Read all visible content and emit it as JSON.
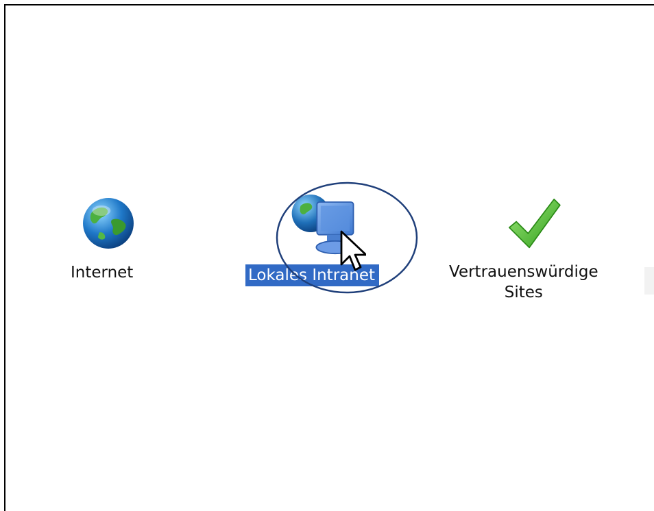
{
  "zones": {
    "internet": {
      "label": "Internet",
      "icon": "globe-icon"
    },
    "intranet": {
      "label": "Lokales Intranet",
      "icon": "local-intranet-icon",
      "selected": true
    },
    "trusted": {
      "label_line1": "Vertrauenswürdige",
      "label_line2": "Sites",
      "icon": "checkmark-icon"
    }
  },
  "colors": {
    "selection_highlight": "#316ac5",
    "annotation_ellipse": "#1f3f7a",
    "checkmark_green": "#3fbf1f"
  }
}
